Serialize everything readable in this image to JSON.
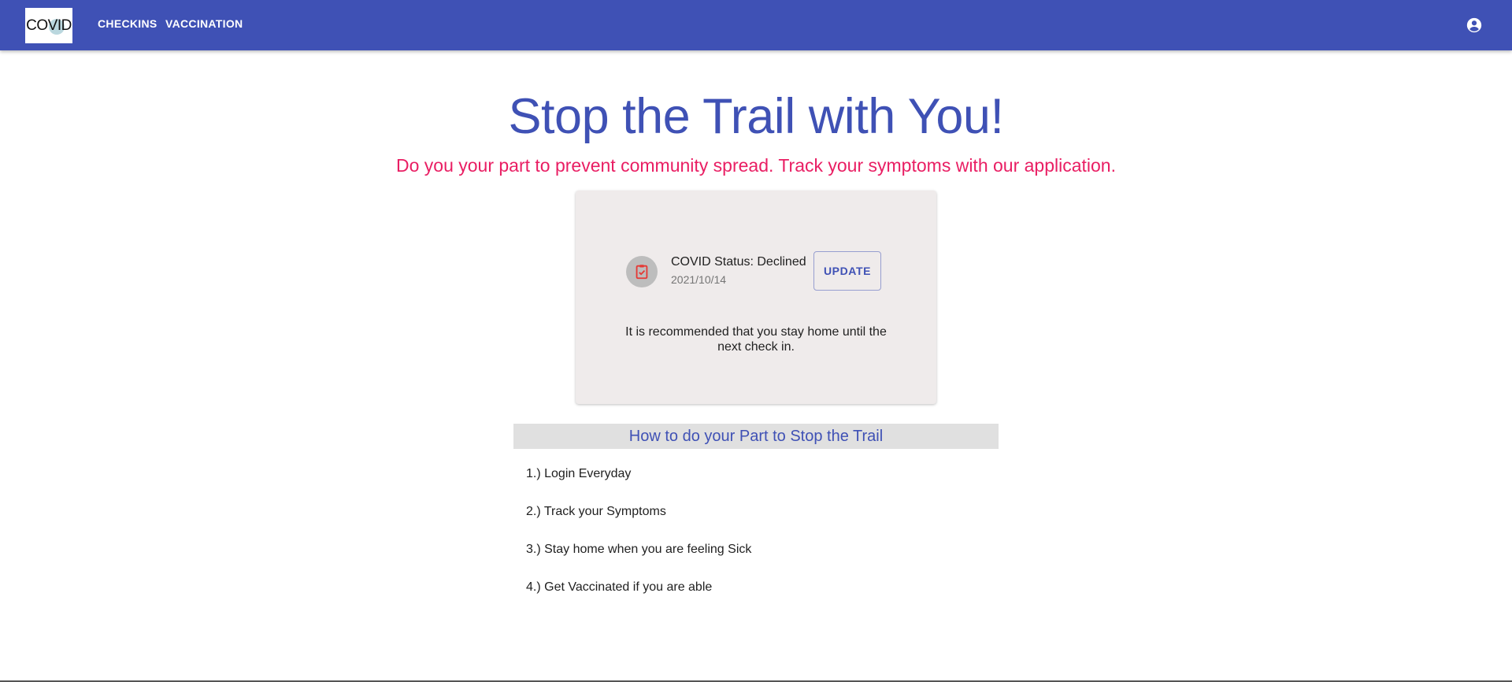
{
  "appbar": {
    "logo_text": "COVID",
    "nav": [
      {
        "label": "CHECKINS"
      },
      {
        "label": "VACCINATION"
      }
    ],
    "account_icon": "account-circle-icon",
    "color": "#3f51b5"
  },
  "hero": {
    "title": "Stop the Trail with You!",
    "subtitle": "Do you your part to prevent community spread. Track your symptoms with our application.",
    "title_color": "#3f51b5",
    "subtitle_color": "#e91e63"
  },
  "status_card": {
    "icon": "clipboard-check-icon",
    "title": "COVID Status: Declined",
    "date": "2021/10/14",
    "update_label": "UPDATE",
    "recommendation": "It is recommended that you stay home until the next check in."
  },
  "howto": {
    "header": "How to do your Part to Stop the Trail",
    "steps": [
      "1.) Login Everyday",
      "2.) Track your Symptoms",
      "3.) Stay home when you are feeling Sick",
      "4.) Get Vaccinated if you are able"
    ]
  }
}
